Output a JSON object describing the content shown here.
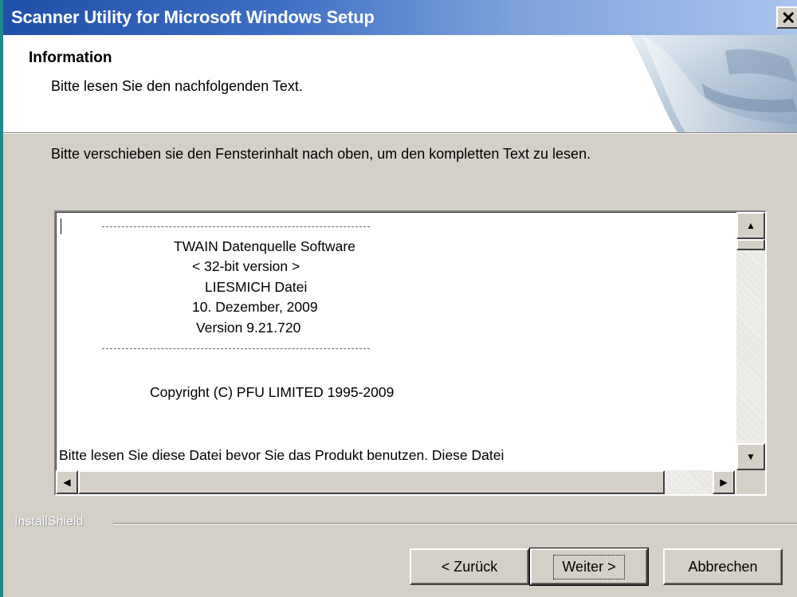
{
  "window": {
    "title": "Scanner Utility for Microsoft Windows Setup",
    "close_glyph": "✕"
  },
  "header": {
    "title": "Information",
    "subtitle": "Bitte lesen Sie den nachfolgenden Text."
  },
  "instruction": "Bitte verschieben sie den Fensterinhalt nach oben, um den kompletten Text zu lesen.",
  "readme": {
    "lines": [
      "TWAIN Datenquelle Software",
      "< 32-bit version >",
      "LIESMICH Datei",
      "10. Dezember, 2009",
      "Version 9.21.720",
      "Copyright (C) PFU LIMITED 1995-2009",
      "Bitte lesen Sie diese Datei bevor Sie das Produkt benutzen.  Diese Datei"
    ]
  },
  "scrollbars": {
    "up_glyph": "▲",
    "down_glyph": "▼",
    "left_glyph": "◀",
    "right_glyph": "▶"
  },
  "footer": {
    "brand": "InstallShield",
    "buttons": {
      "back": "< Zurück",
      "next": "Weiter >",
      "cancel": "Abbrechen"
    }
  },
  "colors": {
    "title_gradient_start": "#1f4fa8",
    "title_gradient_end": "#a9c4ec",
    "dialog_face": "#d4d0c8"
  }
}
